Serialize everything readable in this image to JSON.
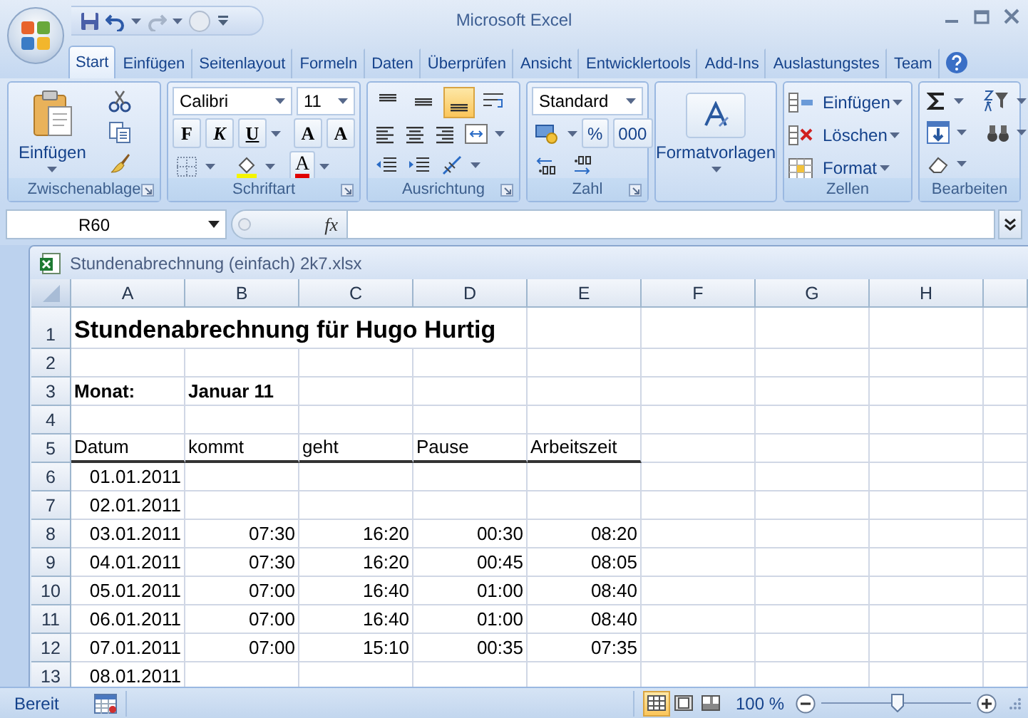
{
  "window": {
    "title": "Microsoft Excel"
  },
  "tabs": [
    {
      "label": "Start",
      "selected": true
    },
    {
      "label": "Einfügen",
      "selected": false
    },
    {
      "label": "Seitenlayout",
      "selected": false
    },
    {
      "label": "Formeln",
      "selected": false
    },
    {
      "label": "Daten",
      "selected": false
    },
    {
      "label": "Überprüfen",
      "selected": false
    },
    {
      "label": "Ansicht",
      "selected": false
    },
    {
      "label": "Entwicklertools",
      "selected": false
    },
    {
      "label": "Add-Ins",
      "selected": false
    },
    {
      "label": "Auslastungstes",
      "selected": false
    },
    {
      "label": "Team",
      "selected": false
    }
  ],
  "ribbon": {
    "groups": [
      {
        "kind": "clipboard",
        "title": "Zwischenablage",
        "paste_label": "Einfügen"
      },
      {
        "kind": "font",
        "title": "Schriftart",
        "font": "Calibri",
        "size": "11",
        "style_buttons": [
          "F",
          "K",
          "U"
        ],
        "size_buttons": [
          "A",
          "A"
        ],
        "font_color_label": "A"
      },
      {
        "kind": "alignment",
        "title": "Ausrichtung",
        "vertical": [
          {
            "selected": false
          },
          {
            "selected": false
          },
          {
            "selected": true
          }
        ]
      },
      {
        "kind": "number",
        "title": "Zahl",
        "format": "Standard",
        "buttons": [
          "%",
          "000"
        ]
      },
      {
        "kind": "styles",
        "label": "Formatvorlagen"
      },
      {
        "kind": "cells",
        "title": "Zellen",
        "buttons": [
          "Einfügen",
          "Löschen",
          "Format"
        ]
      },
      {
        "kind": "editing",
        "title": "Bearbeiten"
      }
    ]
  },
  "formula_bar": {
    "name_box": "R60",
    "function_label": "fx"
  },
  "workbook": {
    "title": "Stundenabrechnung (einfach) 2k7.xlsx",
    "columns": [
      "A",
      "B",
      "C",
      "D",
      "E",
      "F",
      "G",
      "H"
    ],
    "rows": [
      {
        "number": "1",
        "kind": "title",
        "cells": [
          "Stundenabrechnung für Hugo Hurtig"
        ]
      },
      {
        "number": "2",
        "kind": "data"
      },
      {
        "number": "3",
        "kind": "label",
        "cells": [
          "Monat:",
          "Januar 11"
        ]
      },
      {
        "number": "4",
        "kind": "data"
      },
      {
        "number": "5",
        "kind": "header",
        "cells": [
          "Datum",
          "kommt",
          "geht",
          "Pause",
          "Arbeitszeit"
        ]
      },
      {
        "number": "6",
        "kind": "data",
        "cells": [
          "01.01.2011"
        ]
      },
      {
        "number": "7",
        "kind": "data",
        "cells": [
          "02.01.2011"
        ]
      },
      {
        "number": "8",
        "kind": "data",
        "cells": [
          "03.01.2011",
          "07:30",
          "16:20",
          "00:30",
          "08:20"
        ]
      },
      {
        "number": "9",
        "kind": "data",
        "cells": [
          "04.01.2011",
          "07:30",
          "16:20",
          "00:45",
          "08:05"
        ]
      },
      {
        "number": "10",
        "kind": "data",
        "cells": [
          "05.01.2011",
          "07:00",
          "16:40",
          "01:00",
          "08:40"
        ]
      },
      {
        "number": "11",
        "kind": "data",
        "cells": [
          "06.01.2011",
          "07:00",
          "16:40",
          "01:00",
          "08:40"
        ]
      },
      {
        "number": "12",
        "kind": "data",
        "cells": [
          "07.01.2011",
          "07:00",
          "15:10",
          "00:35",
          "07:35"
        ]
      },
      {
        "number": "13",
        "kind": "data",
        "cells": [
          "08.01.2011"
        ]
      }
    ]
  },
  "status_bar": {
    "status": "Bereit",
    "views": [
      {
        "selected": true
      },
      {
        "selected": false
      },
      {
        "selected": false
      }
    ],
    "zoom": "100 %",
    "zoom_slider": {
      "level": 0.5
    }
  }
}
